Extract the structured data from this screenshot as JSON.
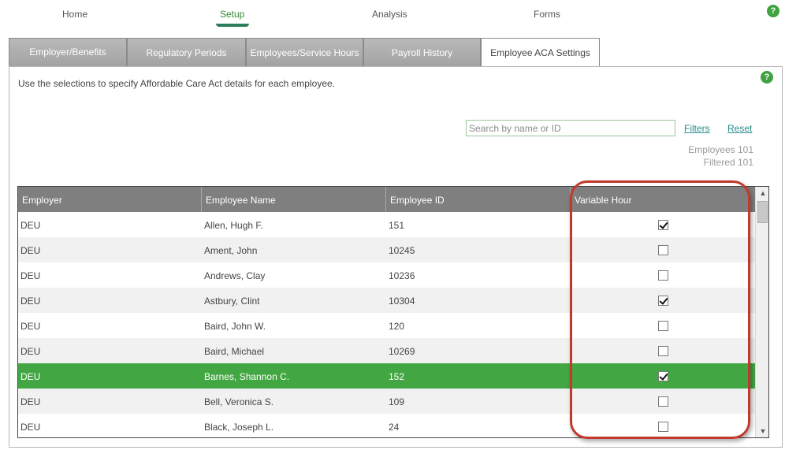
{
  "nav": {
    "items": [
      "Home",
      "Setup",
      "Analysis",
      "Forms"
    ],
    "active": "Setup"
  },
  "help_icon": "?",
  "tabs": [
    "Employer/Benefits",
    "Regulatory Periods",
    "Employees/Service Hours",
    "Payroll History",
    "Employee ACA Settings"
  ],
  "active_tab": "Employee ACA Settings",
  "instructions": "Use the selections to specify Affordable Care Act details for each employee.",
  "search": {
    "placeholder": "Search by name or ID",
    "value": ""
  },
  "links": {
    "filters": "Filters",
    "reset": "Reset"
  },
  "counts": {
    "employees": "Employees 101",
    "filtered": "Filtered 101"
  },
  "grid": {
    "columns": [
      "Employer",
      "Employee Name",
      "Employee ID",
      "Variable Hour"
    ],
    "rows": [
      {
        "employer": "DEU",
        "name": "Allen, Hugh F.",
        "id": "151",
        "variable_hour": true
      },
      {
        "employer": "DEU",
        "name": "Ament, John",
        "id": "10245",
        "variable_hour": false
      },
      {
        "employer": "DEU",
        "name": "Andrews, Clay",
        "id": "10236",
        "variable_hour": false
      },
      {
        "employer": "DEU",
        "name": "Astbury, Clint",
        "id": "10304",
        "variable_hour": true
      },
      {
        "employer": "DEU",
        "name": "Baird, John W.",
        "id": "120",
        "variable_hour": false
      },
      {
        "employer": "DEU",
        "name": "Baird, Michael",
        "id": "10269",
        "variable_hour": false
      },
      {
        "employer": "DEU",
        "name": "Barnes, Shannon C.",
        "id": "152",
        "variable_hour": true,
        "selected": true
      },
      {
        "employer": "DEU",
        "name": "Bell, Veronica S.",
        "id": "109",
        "variable_hour": false
      },
      {
        "employer": "DEU",
        "name": "Black, Joseph L.",
        "id": "24",
        "variable_hour": false
      }
    ]
  },
  "colors": {
    "accent": "#42a742",
    "callout": "#c0392b",
    "header": "#7f7f7f"
  }
}
